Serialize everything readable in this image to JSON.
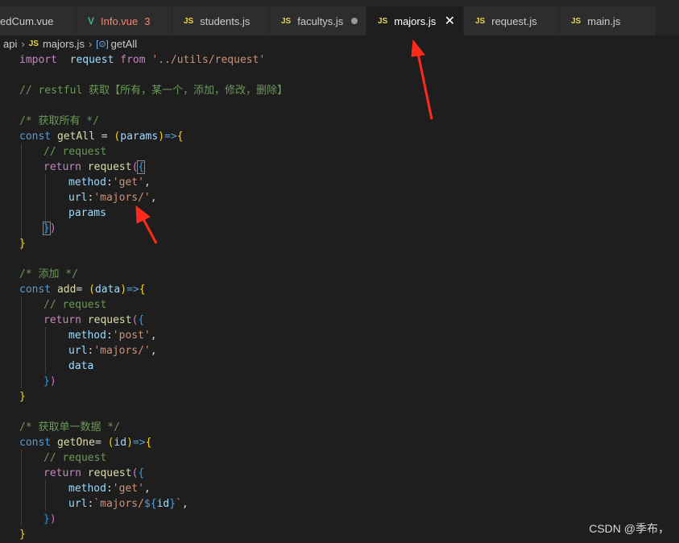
{
  "tabs": [
    {
      "label": "edCum.vue",
      "icon": "",
      "badge": ""
    },
    {
      "label": "Info.vue",
      "icon": "V",
      "badge": "3"
    },
    {
      "label": "students.js",
      "icon": "JS",
      "badge": ""
    },
    {
      "label": "facultys.js",
      "icon": "JS",
      "badge": ""
    },
    {
      "label": "majors.js",
      "icon": "JS",
      "badge": ""
    },
    {
      "label": "request.js",
      "icon": "JS",
      "badge": ""
    },
    {
      "label": "main.js",
      "icon": "JS",
      "badge": ""
    }
  ],
  "breadcrumb": {
    "folder": "api",
    "file_icon": "JS",
    "file": "majors.js",
    "symbol": "getAll"
  },
  "code": {
    "l1": {
      "kw": "import",
      "id": "request",
      "from": "from",
      "str": "'../utils/request'"
    },
    "l3": "// restful 获取【所有，某一个，添加，修改，删除】",
    "l5": "/* 获取所有 */",
    "l6": {
      "const": "const",
      "name": "getAll",
      "eq": " = ",
      "param": "params",
      "arrow": "=>"
    },
    "l7": "// request",
    "l8": {
      "ret": "return",
      "fn": "request"
    },
    "l9": {
      "key": "method",
      "val": "'get'"
    },
    "l10": {
      "key": "url",
      "val": "'majors/'"
    },
    "l11": "params",
    "l14": "/* 添加 */",
    "l15": {
      "const": "const",
      "name": "add",
      "eq": "= ",
      "param": "data",
      "arrow": "=>"
    },
    "l16": "// request",
    "l17": {
      "ret": "return",
      "fn": "request"
    },
    "l18": {
      "key": "method",
      "val": "'post'"
    },
    "l19": {
      "key": "url",
      "val": "'majors/'"
    },
    "l20": "data",
    "l24": "/* 获取单一数据 */",
    "l25": {
      "const": "const",
      "name": "getOne",
      "eq": "= ",
      "param": "id",
      "arrow": "=>"
    },
    "l26": "// request",
    "l27": {
      "ret": "return",
      "fn": "request"
    },
    "l28": {
      "key": "method",
      "val": "'get'"
    },
    "l29": {
      "key": "url",
      "tpl_a": "`majors/",
      "tpl_open": "${",
      "tpl_var": "id",
      "tpl_close": "}",
      "tpl_b": "`"
    }
  },
  "watermark": "CSDN @季布，",
  "colors": {
    "keyword": "#c586c0",
    "storage": "#569cd6",
    "function": "#dcdcaa",
    "variable": "#9cdcfe",
    "string": "#ce9178",
    "comment": "#6a9955",
    "arrow_annotation": "#ff2a1a"
  }
}
